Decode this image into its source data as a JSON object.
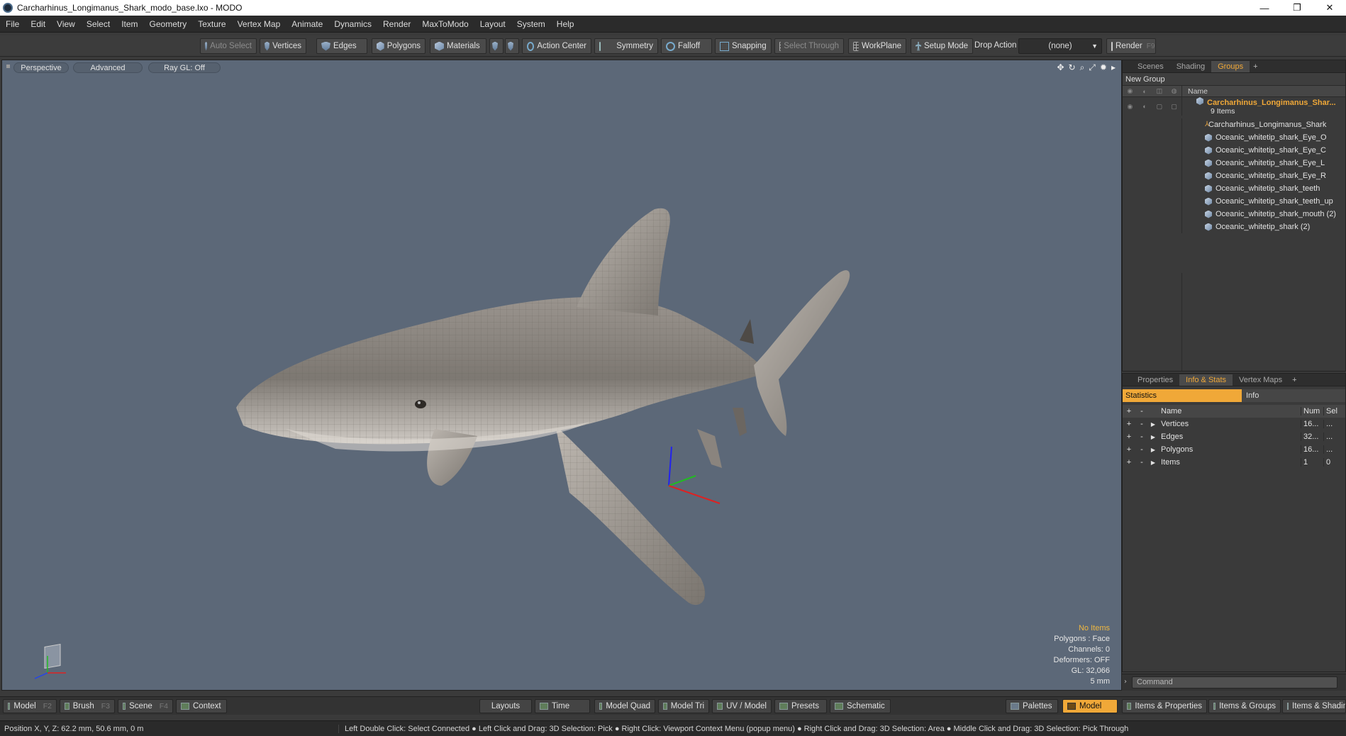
{
  "window": {
    "title": "Carcharhinus_Longimanus_Shark_modo_base.lxo - MODO",
    "minimize": "—",
    "maximize": "❐",
    "close": "✕"
  },
  "menu": [
    "File",
    "Edit",
    "View",
    "Select",
    "Item",
    "Geometry",
    "Texture",
    "Vertex Map",
    "Animate",
    "Dynamics",
    "Render",
    "MaxToModo",
    "Layout",
    "System",
    "Help"
  ],
  "toolbar": {
    "auto_select": "Auto Select",
    "vertices": "Vertices",
    "edges": "Edges",
    "polygons": "Polygons",
    "materials": "Materials",
    "action_center": "Action Center",
    "symmetry": "Symmetry",
    "falloff": "Falloff",
    "snapping": "Snapping",
    "select_through": "Select Through",
    "workplane": "WorkPlane",
    "setup_mode": "Setup Mode",
    "drop_action_label": "Drop Action",
    "drop_action_value": "(none)",
    "render": "Render",
    "render_key": "F9"
  },
  "viewport": {
    "tabs": [
      "Perspective",
      "Advanced",
      "Ray GL: Off"
    ],
    "info": {
      "items": "No Items",
      "polygons": "Polygons : Face",
      "channels": "Channels: 0",
      "deformers": "Deformers: OFF",
      "gl": "GL: 32,066",
      "scale": "5 mm"
    }
  },
  "groups_panel": {
    "tabs": [
      "Scenes",
      "Shading",
      "Groups"
    ],
    "active_tab": "Groups",
    "new_group": "New Group",
    "column_name": "Name",
    "root": {
      "name": "Carcharhinus_Longimanus_Shar...",
      "count": "9 Items"
    },
    "children": [
      "Carcharhinus_Longimanus_Shark",
      "Oceanic_whitetip_shark_Eye_O",
      "Oceanic_whitetip_shark_Eye_C",
      "Oceanic_whitetip_shark_Eye_L",
      "Oceanic_whitetip_shark_Eye_R",
      "Oceanic_whitetip_shark_teeth",
      "Oceanic_whitetip_shark_teeth_up",
      "Oceanic_whitetip_shark_mouth (2)",
      "Oceanic_whitetip_shark (2)"
    ]
  },
  "stats_panel": {
    "tabs": [
      "Properties",
      "Info & Stats",
      "Vertex Maps"
    ],
    "active_tab": "Info & Stats",
    "sub_tabs": [
      "Statistics",
      "Info"
    ],
    "columns": {
      "name": "Name",
      "num": "Num",
      "sel": "Sel"
    },
    "rows": [
      {
        "name": "Vertices",
        "num": "16...",
        "sel": "..."
      },
      {
        "name": "Edges",
        "num": "32...",
        "sel": "..."
      },
      {
        "name": "Polygons",
        "num": "16...",
        "sel": "..."
      },
      {
        "name": "Items",
        "num": "1",
        "sel": "0"
      }
    ]
  },
  "command": {
    "placeholder": "Command"
  },
  "bottom_bar": {
    "model": "Model",
    "model_key": "F2",
    "brush": "Brush",
    "brush_key": "F3",
    "scene": "Scene",
    "scene_key": "F4",
    "context": "Context",
    "layouts": "Layouts",
    "time": "Time",
    "model_quad": "Model Quad",
    "model_tri": "Model Tri",
    "uv_model": "UV / Model",
    "presets": "Presets",
    "schematic": "Schematic",
    "palettes": "Palettes",
    "model_active": "Model",
    "items_properties": "Items & Properties",
    "items_groups": "Items & Groups",
    "items_shading": "Items & Shadin"
  },
  "status": {
    "position": "Position X, Y, Z:   62.2 mm, 50.6 mm, 0 m",
    "hint": "Left Double Click: Select Connected ● Left Click and Drag: 3D Selection: Pick ● Right Click: Viewport Context Menu (popup menu) ● Right Click and Drag: 3D Selection: Area ● Middle Click and Drag: 3D Selection: Pick Through"
  },
  "colors": {
    "accent": "#f0a838",
    "viewport_bg": "#5c6878",
    "panel_bg": "#3a3a3a"
  }
}
